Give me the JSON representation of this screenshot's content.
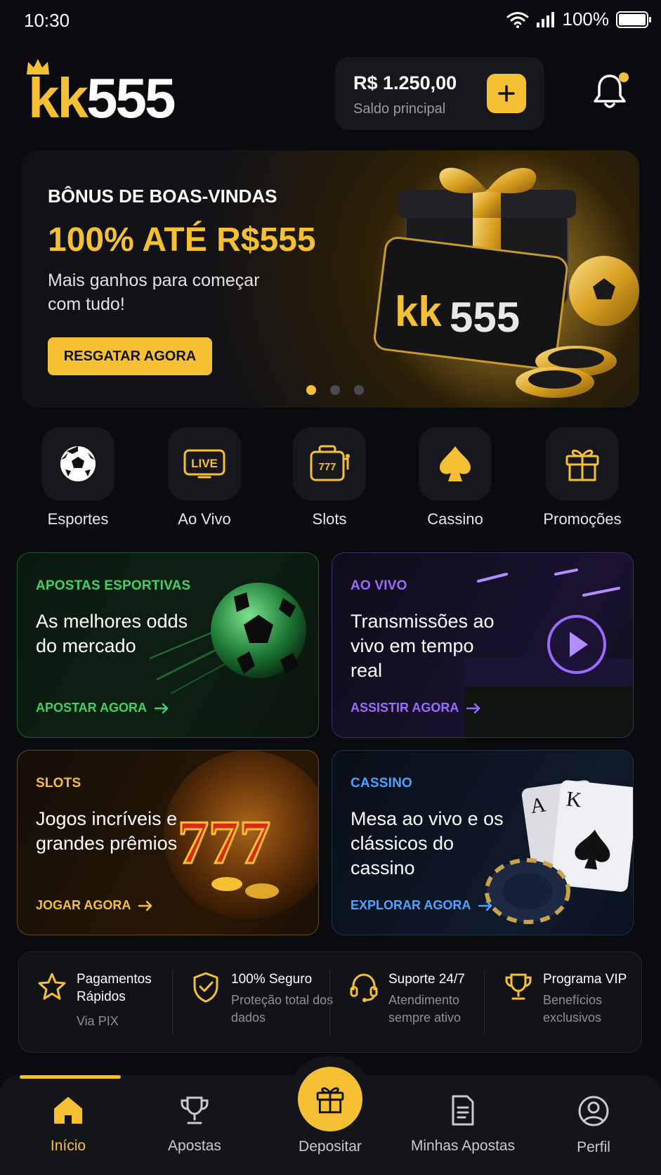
{
  "status": {
    "time": "10:30",
    "battery": "100%"
  },
  "header": {
    "logo_kk": "kk",
    "logo_num": "555",
    "balance_amount": "R$ 1.250,00",
    "balance_label": "Saldo principal"
  },
  "banner": {
    "kicker": "BÔNUS DE BOAS-VINDAS",
    "title": "100% ATÉ R$555",
    "description": "Mais ganhos para começar com tudo!",
    "cta": "RESGATAR AGORA",
    "art_logo_kk": "kk",
    "art_logo_num": "555",
    "active_slide": 1,
    "slide_count": 3
  },
  "categories": [
    {
      "label": "Esportes",
      "icon": "soccer-ball-icon"
    },
    {
      "label": "Ao Vivo",
      "icon": "live-icon",
      "icon_text": "LIVE"
    },
    {
      "label": "Slots",
      "icon": "slot-machine-icon",
      "icon_text": "777"
    },
    {
      "label": "Cassino",
      "icon": "spade-icon"
    },
    {
      "label": "Promoções",
      "icon": "gift-icon"
    }
  ],
  "cards": {
    "sports": {
      "kicker": "APOSTAS ESPORTIVAS",
      "title": "As melhores odds do mercado",
      "link": "APOSTAR AGORA",
      "accent": "#3ed26a"
    },
    "live": {
      "kicker": "AO VIVO",
      "title": "Transmissões ao vivo em tempo real",
      "link": "ASSISTIR AGORA",
      "accent": "#9b6bff"
    },
    "slots": {
      "kicker": "SLOTS",
      "title": "Jogos incríveis e grandes prêmios",
      "link": "JOGAR AGORA",
      "accent": "#f5c033"
    },
    "casino": {
      "kicker": "CASSINO",
      "title": "Mesa ao vivo e os clássicos do cassino",
      "link": "EXPLORAR AGORA",
      "accent": "#4aa3ff"
    }
  },
  "features": [
    {
      "title": "Pagamentos Rápidos",
      "desc": "Via PIX",
      "icon": "star-icon"
    },
    {
      "title": "100% Seguro",
      "desc": "Proteção total dos dados",
      "icon": "shield-check-icon"
    },
    {
      "title": "Suporte 24/7",
      "desc": "Atendimento sempre ativo",
      "icon": "headset-icon"
    },
    {
      "title": "Programa VIP",
      "desc": "Benefícios exclusivos",
      "icon": "trophy-icon"
    }
  ],
  "nav": {
    "home": "Início",
    "bets": "Apostas",
    "deposit": "Depositar",
    "my_bets": "Minhas Apostas",
    "profile": "Perfil"
  },
  "colors": {
    "accent": "#f5c033",
    "background": "#0a0b0e"
  }
}
